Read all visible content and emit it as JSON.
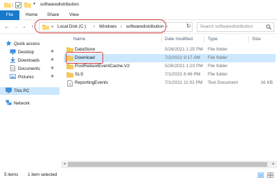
{
  "window": {
    "title": "softwaredistribution"
  },
  "ribbon": {
    "tabs": [
      "File",
      "Home",
      "Share",
      "View"
    ]
  },
  "address": {
    "breadcrumbs": [
      "Local Disk (C:)",
      "Windows",
      "softwaredistribution"
    ],
    "overflow": "«",
    "separator": "›"
  },
  "search": {
    "placeholder": "Search softwaredistribution"
  },
  "navpane": {
    "items": [
      {
        "label": "Quick access",
        "icon": "star-icon"
      },
      {
        "label": "Desktop",
        "icon": "desktop-folder-icon",
        "pinned": true
      },
      {
        "label": "Downloads",
        "icon": "downloads-icon",
        "pinned": true
      },
      {
        "label": "Documents",
        "icon": "documents-icon",
        "pinned": true
      },
      {
        "label": "Pictures",
        "icon": "pictures-icon",
        "pinned": true
      },
      {
        "label": "This PC",
        "icon": "computer-icon",
        "selected": true
      },
      {
        "label": "Network",
        "icon": "network-icon"
      }
    ]
  },
  "filelist": {
    "columns": [
      "Name",
      "Date modified",
      "Type",
      "Size"
    ],
    "rows": [
      {
        "name": "DataStore",
        "date": "5/26/2021 1:25 PM",
        "type": "File folder",
        "size": "",
        "icon": "folder-icon"
      },
      {
        "name": "Download",
        "date": "7/2/2021 9:17 AM",
        "type": "File folder",
        "size": "",
        "icon": "folder-icon",
        "selected": true
      },
      {
        "name": "PostRebootEventCache.V2",
        "date": "5/26/2021 1:23 PM",
        "type": "File folder",
        "size": "",
        "icon": "folder-icon"
      },
      {
        "name": "SLS",
        "date": "7/1/2021 6:46 PM",
        "type": "File folder",
        "size": "",
        "icon": "folder-icon"
      },
      {
        "name": "ReportingEvents",
        "date": "7/1/2021 11:02 PM",
        "type": "Text Document",
        "size": "16 KB",
        "icon": "text-file-icon"
      }
    ]
  },
  "status": {
    "item_count": "5 items",
    "selection": "1 item selected"
  },
  "colors": {
    "accent": "#1979ca",
    "selection": "#cce8ff",
    "folder": "#f4c95b",
    "highlight_annotation": "#d23b3b"
  }
}
